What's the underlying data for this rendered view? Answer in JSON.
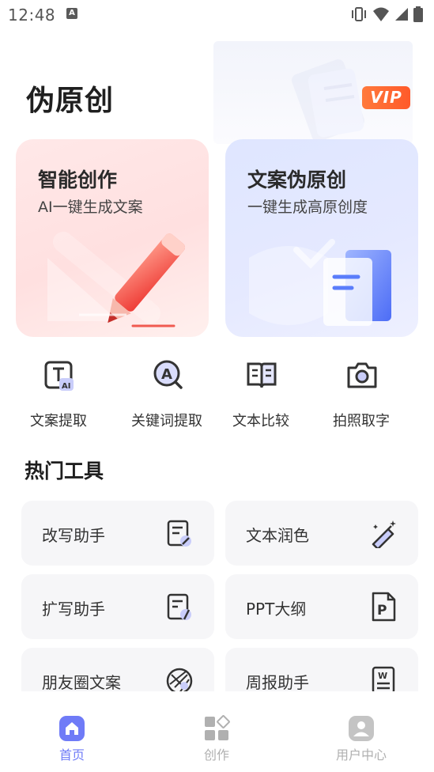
{
  "status_bar": {
    "time": "12:48",
    "a_icon": "A"
  },
  "header": {
    "title": "伪原创",
    "vip_badge": "VIP"
  },
  "feature_cards": [
    {
      "title": "智能创作",
      "subtitle": "AI一键生成文案",
      "icon": "pencil-icon"
    },
    {
      "title": "文案伪原创",
      "subtitle": "一键生成高原创度",
      "icon": "document-icon"
    }
  ],
  "quick_actions": [
    {
      "label": "文案提取",
      "icon": "text-ai-icon"
    },
    {
      "label": "关键词提取",
      "icon": "keyword-search-icon"
    },
    {
      "label": "文本比较",
      "icon": "book-compare-icon"
    },
    {
      "label": "拍照取字",
      "icon": "camera-icon"
    }
  ],
  "hot_tools": {
    "title": "热门工具",
    "items": [
      {
        "label": "改写助手",
        "icon": "edit-note-icon"
      },
      {
        "label": "文本润色",
        "icon": "magic-pen-icon"
      },
      {
        "label": "扩写助手",
        "icon": "expand-note-icon"
      },
      {
        "label": "PPT大纲",
        "icon": "ppt-icon"
      },
      {
        "label": "朋友圈文案",
        "icon": "aperture-icon"
      },
      {
        "label": "周报助手",
        "icon": "word-doc-icon"
      }
    ]
  },
  "bottom_nav": [
    {
      "label": "首页",
      "icon": "home-icon",
      "active": true
    },
    {
      "label": "创作",
      "icon": "grid-icon",
      "active": false
    },
    {
      "label": "用户中心",
      "icon": "user-icon",
      "active": false
    }
  ],
  "colors": {
    "accent": "#6f7bf7",
    "vip_orange": "#ff6a30",
    "nav_inactive": "#b0b0b0",
    "pencil_red": "#f04a45",
    "doc_blue": "#5a7dfb"
  }
}
